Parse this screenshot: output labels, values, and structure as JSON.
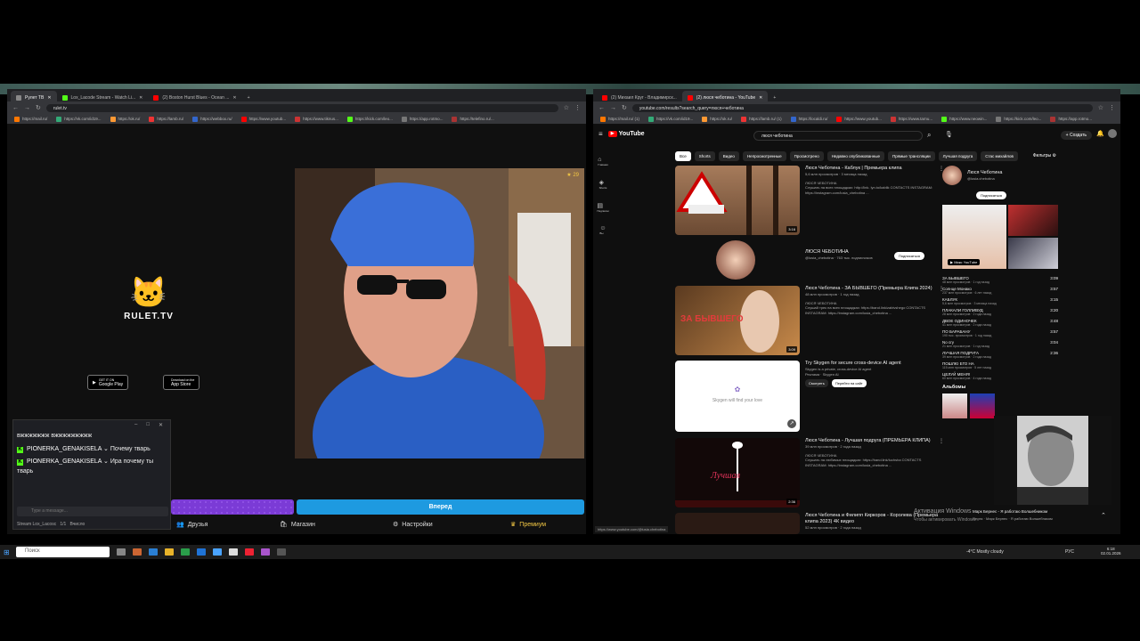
{
  "left_browser": {
    "tabs": [
      "Рулет ТВ",
      "Lox_Lacode Stream - Watch Li...",
      "(2) Boston Hurst Blues - Ocean ..."
    ],
    "url": "rulet.tv",
    "bookmarks": [
      "https://mail.ru/",
      "https://vk.com/id19...",
      "https://ok.ru/",
      "https://lamb.ru/",
      "https://webbox.ru/",
      "https://www.youtub...",
      "https://www.tiknus...",
      "https://kick.com/leo...",
      "https://app.rotmo...",
      "https://telefino.ru/..."
    ]
  },
  "rulet": {
    "logo_text": "RULET.TV",
    "google_play_small": "GET IT ON",
    "google_play": "Google Play",
    "app_store_small": "Download on the",
    "app_store": "App Store",
    "star_count": "29",
    "next_button": "Вперед",
    "nav": [
      "Друзья",
      "Магазин",
      "Настройки",
      "Премиум"
    ]
  },
  "chat": {
    "messages": [
      {
        "user": "",
        "text": "вжжжжжжж вжжжжжжжжж"
      },
      {
        "user": "PIONERKA_GENAKISELA",
        "text": "Почему тварь"
      },
      {
        "user": "PIONERKA_GENAKISELA",
        "text": "Ира почему ты тварь"
      }
    ],
    "placeholder": "Type a message...",
    "footer_channel": "Stream Lox_Lacosc",
    "footer_count": "1/1",
    "footer_extra": "Вчисло"
  },
  "right_browser": {
    "tabs": [
      "(2) Михаил Круг - Владимирск...",
      "(2) люся чеботина - YouTube"
    ],
    "url": "youtube.com/results?search_query=люся+чеботина",
    "bookmarks": [
      "https://mail.ru/ (1)",
      "https://vk.com/id19...",
      "https://ok.ru/",
      "https://lamb.ru/ (1)",
      "https://localdi.ru/",
      "https://www.youtub...",
      "https://www.tarnu...",
      "https://www.neowin...",
      "https://kick.com/leo...",
      "https://app.rotmo..."
    ]
  },
  "youtube": {
    "logo": "YouTube",
    "search": "люся чеботина",
    "create": "Создать",
    "chips": [
      "Все",
      "Shorts",
      "Видео",
      "Непросмотренные",
      "Просмотрено",
      "Недавно опубликованные",
      "Прямые трансляции",
      "Лучшая подруга",
      "Стас михайлов"
    ],
    "filters": "Фильтры",
    "leftnav": [
      "Главная",
      "Shorts",
      "Подписки",
      "Вы"
    ],
    "videos": [
      {
        "title": "Люся Чеботина - Каблук | Премьера клипа",
        "stats": "5,6 млн просмотров · 3 месяца назад",
        "channel": "ЛЮСЯ ЧЕБОТИНА",
        "desc": "Слушать на всех площадках: http://link. lyn.to/kablik CONTACTS INSTAGRAM: https://instagram.com/lusia_chebotina ...",
        "duration": "3:16"
      },
      {
        "title": "ЛЮСЯ ЧЕБОТИНА",
        "stats": "@lusia_chebotina · 763 тыс. подписчиков",
        "subscribe": "Подписаться"
      },
      {
        "title": "Люся Чеботина - ЗА БЫВШЕГО (Премьера Клипа 2024)",
        "stats": "48 млн просмотров · 1 год назад",
        "channel": "ЛЮСЯ ЧЕБОТИНА",
        "desc": "Слушай трек на всех площадках: https://band.link/zabivshego CONTACTS INSTAGRAM: https://instagram.com/lusia_chebotina ...",
        "duration": "3:09"
      },
      {
        "title": "Try Skygen for secure cross-device AI agent",
        "stats": "Skygen is a private, cross-device AI agent",
        "channel": "Реклама · Skygen AI",
        "btn1": "Смотреть",
        "btn2": "Перейти на сайт",
        "ad_text": "Skygen will find your love"
      },
      {
        "title": "Люся Чеботина - Лучшая подруга (ПРЕМЬЕРА КЛИПА)",
        "stats": "39 млн просмотров · 2 года назад",
        "channel": "ЛЮСЯ ЧЕБОТИНА",
        "desc": "Слушать на любимых площадках: https://band.link/luchsha CONTACTS INSTAGRAM: https://instagram.com/lusia_chebotina ...",
        "duration": "2:36"
      },
      {
        "title": "Люся Чеботина и Филипп Киркоров - Королева (Премьера клипа 2023) 4К видео",
        "stats": "52 млн просмотров · 2 года назад"
      }
    ],
    "side_card": {
      "name": "Люся Чеботина",
      "handle": "@lusia.chebotina",
      "subscribe": "Подписаться",
      "mix": "Микс YouTube",
      "albums": "Альбомы",
      "songs": [
        {
          "t": "ЗА БЫВШЕГО",
          "s": "48 млн просмотров · 1 год назад",
          "d": "3:09"
        },
        {
          "t": "Солнце Монако",
          "s": "237 млн просмотров · 6 лет назад",
          "d": "3:57"
        },
        {
          "t": "КАБЛУК",
          "s": "5,6 млн просмотров · 3 месяца назад",
          "d": "3:15"
        },
        {
          "t": "ПЛАКАЛИ ГОЛЛИВУД",
          "s": "28 млн просмотров · 2 года назад",
          "d": "3:20"
        },
        {
          "t": "ДВОЕ ОДИНОЧЕК",
          "s": "41 млн просмотров · 2 года назад",
          "d": "3:48"
        },
        {
          "t": "ПО БАРАБАНУ",
          "s": "190 тыс. просмотров · 1 год назад",
          "d": "3:57"
        },
        {
          "t": "No cry",
          "s": "21 млн просмотров · 1 год назад",
          "d": "3:04"
        },
        {
          "t": "ЛУЧШАЯ ПОДРУГА",
          "s": "39 млн просмотров · 2 года назад",
          "d": "2:36"
        },
        {
          "t": "ПОШЛЮ ЕГО НА",
          "s": "115 млн просмотров · 5 лет назад",
          "d": ""
        },
        {
          "t": "ЦЕЛУЙ МЕНЯ!",
          "s": "60 млн просмотров · 4 года назад",
          "d": ""
        }
      ]
    },
    "status_url": "https://www.youtube.com/@lusia.chebotina"
  },
  "overlay": {
    "activation": "Активация Windows",
    "activation_sub": "Чтобы активировать Windows...",
    "now_playing": "Марк Бернес - Я работаю Волшебником",
    "now_playing_sub": "Песня · Марк Бернес · Я работаю Волшебником"
  },
  "taskbar": {
    "search": "Поиск",
    "weather": "-4°C  Mostly cloudy",
    "lang": "РУС",
    "time": "6:18",
    "date": "02.01.2026"
  }
}
